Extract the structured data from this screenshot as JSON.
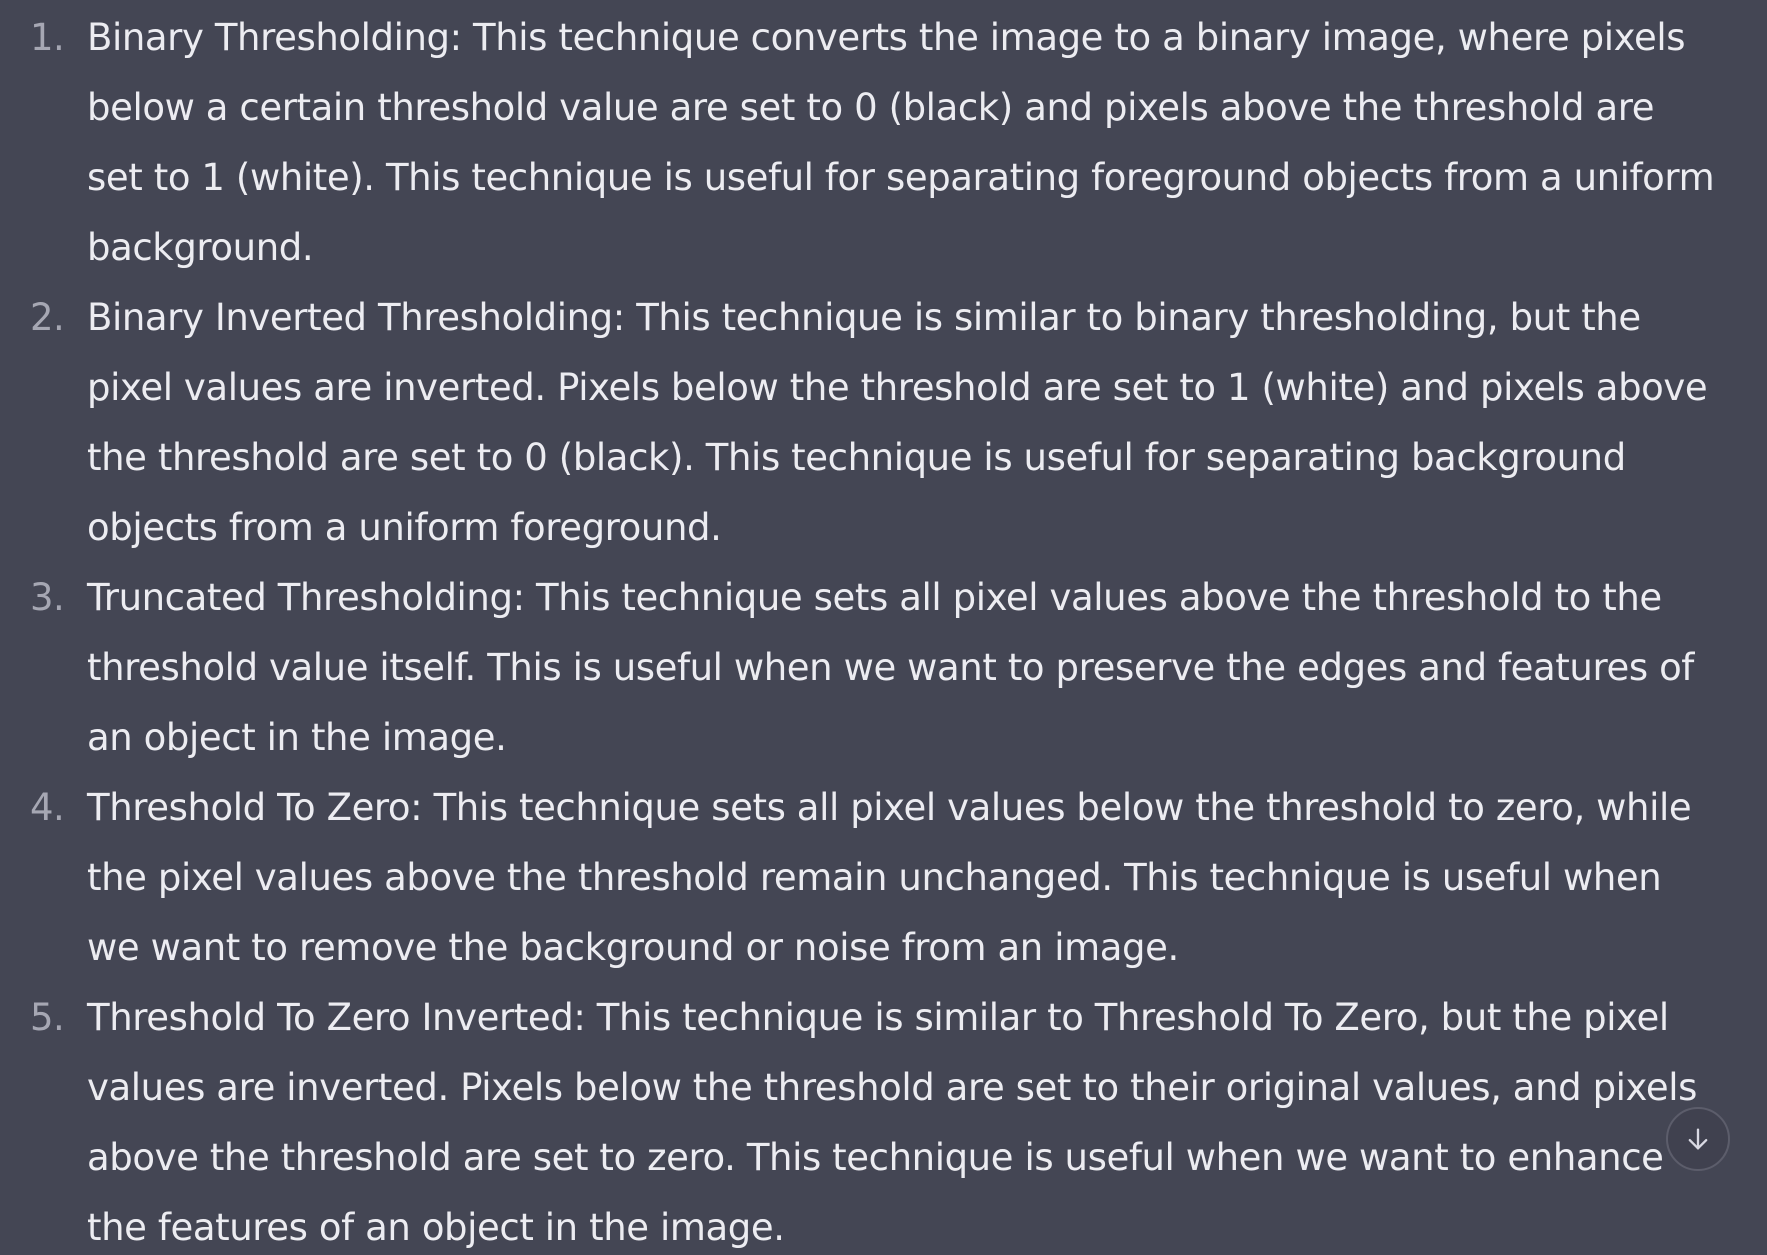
{
  "response": {
    "items": [
      {
        "number": "1.",
        "text": "Binary Thresholding: This technique converts the image to a binary image, where pixels below a certain threshold value are set to 0 (black) and pixels above the threshold are set to 1 (white). This technique is useful for separating foreground objects from a uniform background."
      },
      {
        "number": "2.",
        "text": "Binary Inverted Thresholding: This technique is similar to binary thresholding, but the pixel values are inverted. Pixels below the threshold are set to 1 (white) and pixels above the threshold are set to 0 (black). This technique is useful for separating background objects from a uniform foreground."
      },
      {
        "number": "3.",
        "text": "Truncated Thresholding: This technique sets all pixel values above the threshold to the threshold value itself. This is useful when we want to preserve the edges and features of an object in the image."
      },
      {
        "number": "4.",
        "text": "Threshold To Zero: This technique sets all pixel values below the threshold to zero, while the pixel values above the threshold remain unchanged. This technique is useful when we want to remove the background or noise from an image."
      },
      {
        "number": "5.",
        "text": "Threshold To Zero Inverted: This technique is similar to Threshold To Zero, but the pixel values are inverted. Pixels below the threshold are set to their original values, and pixels above the threshold are set to zero. This technique is useful when we want to enhance the features of an object in the image."
      }
    ]
  },
  "scroll_button": {
    "icon": "arrow-down-icon"
  },
  "colors": {
    "background": "#444654",
    "text": "#ececf1",
    "list_number": "#a6a7b3"
  }
}
